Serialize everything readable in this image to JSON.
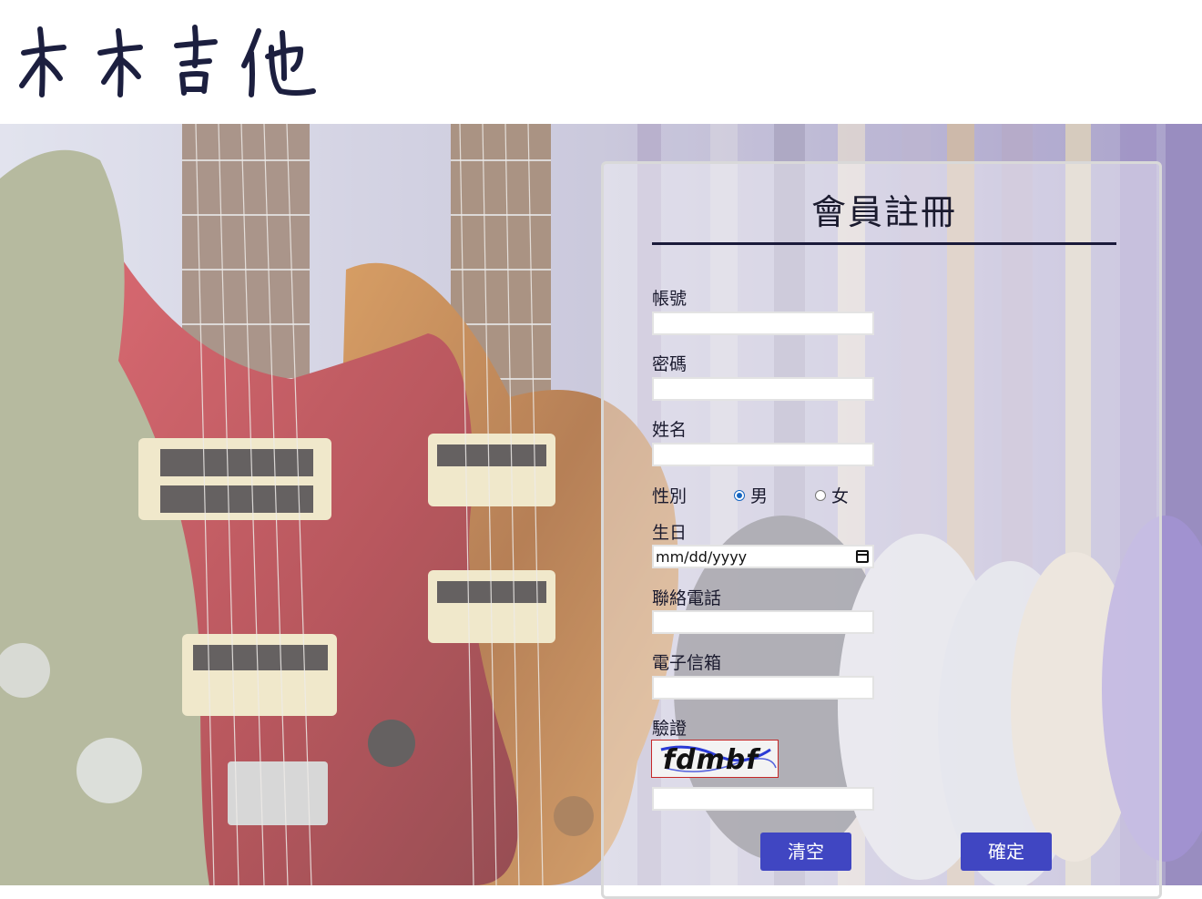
{
  "brand": {
    "logo_text": "木木吉他"
  },
  "form": {
    "title": "會員註冊",
    "fields": {
      "account": {
        "label": "帳號",
        "value": ""
      },
      "password": {
        "label": "密碼",
        "value": ""
      },
      "name": {
        "label": "姓名",
        "value": ""
      },
      "gender": {
        "label": "性別",
        "options": [
          {
            "label": "男",
            "checked": true
          },
          {
            "label": "女",
            "checked": false
          }
        ]
      },
      "birthday": {
        "label": "生日",
        "placeholder": "mm/dd/yyyy"
      },
      "phone": {
        "label": "聯絡電話",
        "value": ""
      },
      "email": {
        "label": "電子信箱",
        "value": ""
      },
      "verify": {
        "label": "驗證",
        "captcha_text": "fdmbf",
        "value": ""
      }
    },
    "buttons": {
      "clear": "清空",
      "submit": "確定"
    }
  },
  "colors": {
    "button": "#4046c2",
    "title_rule": "#1a1a3a",
    "captcha_border": "#c62828",
    "radio_accent": "#1565c0"
  },
  "icons": {
    "date_picker": "calendar-icon"
  }
}
